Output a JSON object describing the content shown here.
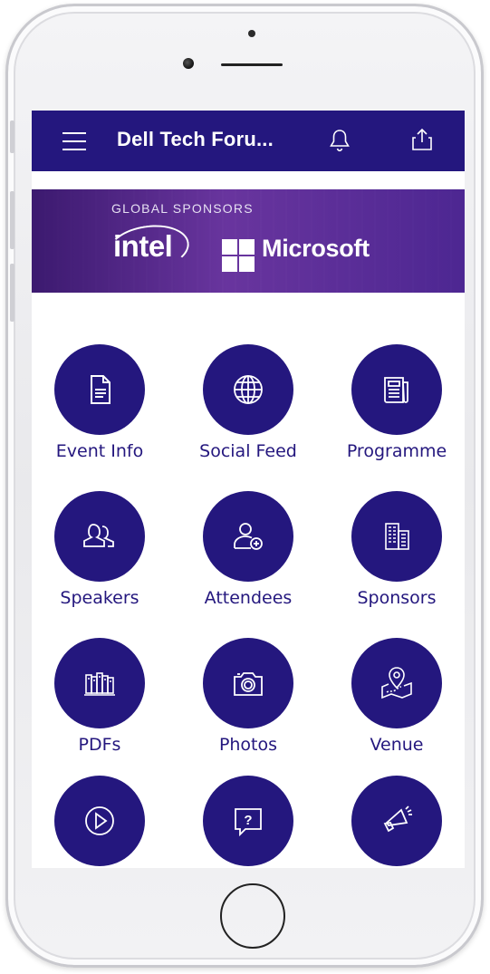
{
  "app": {
    "title": "Dell Tech Foru..."
  },
  "banner": {
    "label": "GLOBAL SPONSORS",
    "sponsor_1": "intel",
    "sponsor_2": "Microsoft"
  },
  "tiles": [
    {
      "label": "Event Info",
      "icon": "document-icon"
    },
    {
      "label": "Social Feed",
      "icon": "globe-icon"
    },
    {
      "label": "Programme",
      "icon": "newspaper-icon"
    },
    {
      "label": "Speakers",
      "icon": "people-icon"
    },
    {
      "label": "Attendees",
      "icon": "add-user-icon"
    },
    {
      "label": "Sponsors",
      "icon": "building-icon"
    },
    {
      "label": "PDFs",
      "icon": "books-icon"
    },
    {
      "label": "Photos",
      "icon": "camera-icon"
    },
    {
      "label": "Venue",
      "icon": "map-pin-icon"
    },
    {
      "label": "",
      "icon": "play-icon"
    },
    {
      "label": "",
      "icon": "question-chat-icon"
    },
    {
      "label": "",
      "icon": "megaphone-icon"
    }
  ],
  "colors": {
    "primary": "#24177e",
    "banner": "#3a1f7a",
    "background": "#ffffff"
  }
}
